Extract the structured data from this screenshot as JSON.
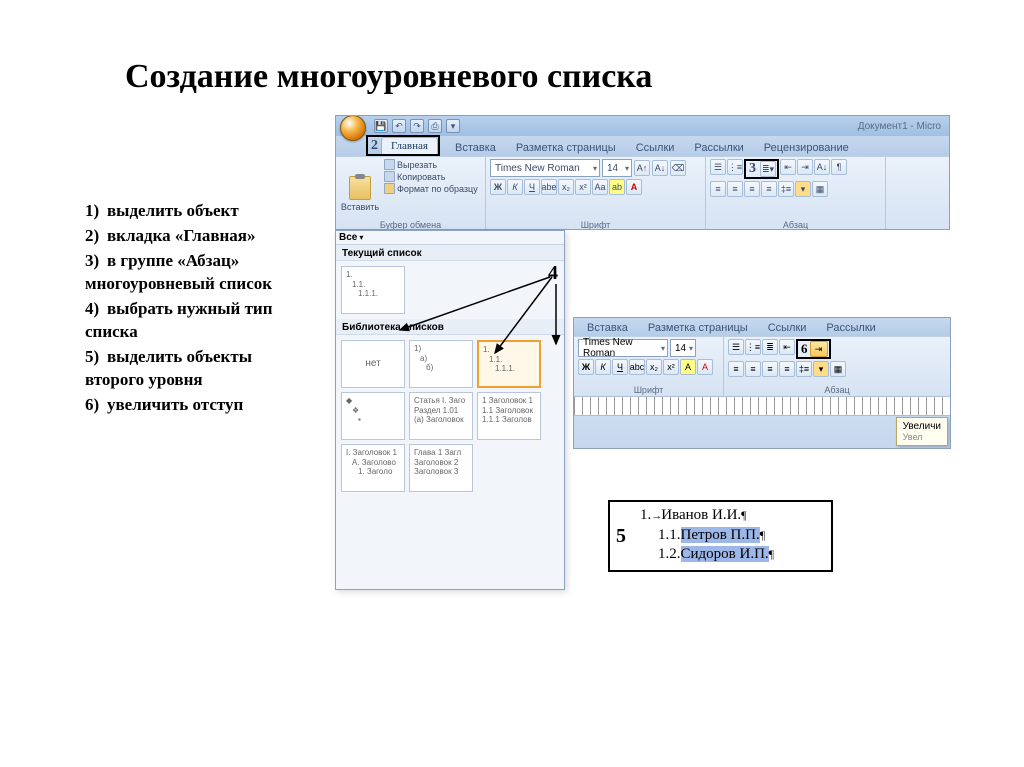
{
  "title": "Создание многоуровневого списка",
  "steps": [
    "выделить объект",
    "вкладка «Главная»",
    "в группе «Абзац» многоуровневый список",
    "выбрать нужный тип списка",
    "выделить объекты второго уровня",
    "увеличить отступ"
  ],
  "doc_title": "Документ1 - Micro",
  "tabs": {
    "t1": "Главная",
    "t2": "Вставка",
    "t3": "Разметка страницы",
    "t4": "Ссылки",
    "t5": "Рассылки",
    "t6": "Рецензирование"
  },
  "clipboard": {
    "paste": "Вставить",
    "cut": "Вырезать",
    "copy": "Копировать",
    "fmt": "Формат по образцу",
    "label": "Буфер обмена"
  },
  "font": {
    "name": "Times New Roman",
    "size": "14",
    "label": "Шрифт"
  },
  "para": {
    "label": "Абзац"
  },
  "gallery": {
    "all": "Все",
    "current": "Текущий список",
    "library": "Библиотека списков",
    "none": "нет",
    "cur_l1": "1.",
    "cur_l2": "1.1.",
    "cur_l3": "1.1.1.",
    "t1_l1": "1)",
    "t1_l2": "a)",
    "t1_l3": "б)",
    "t2_l1": "1.",
    "t2_l2": "1.1.",
    "t2_l3": "1.1.1.",
    "t3_l1": "◆",
    "t3_l2": "❖",
    "t3_l3": "▪",
    "t4_l1": "Статья I. Заго",
    "t4_l2": "Раздел 1.01",
    "t4_l3": "(a) Заголовок",
    "t5_l1": "1 Заголовок 1",
    "t5_l2": "1.1 Заголовок",
    "t5_l3": "1.1.1 Заголов",
    "t6_l1": "I. Заголовок 1",
    "t6_l2": "A. Заголово",
    "t6_l3": "1. Заголо",
    "t7_l1": "Глава 1 Загл",
    "t7_l2": "Заголовок 2",
    "t7_l3": "Заголовок 3"
  },
  "tooltip": "Увеличи",
  "tooltip2": "Увел",
  "sample": {
    "row1_num": "1.",
    "row1_txt": "Иванов И.И.",
    "row2_num": "1.1.",
    "row2_txt": "Петров П.П.",
    "row3_num": "1.2.",
    "row3_txt": "Сидоров И.П."
  },
  "callouts": {
    "n2": "2",
    "n3": "3",
    "n4": "4",
    "n5": "5",
    "n6": "6"
  }
}
